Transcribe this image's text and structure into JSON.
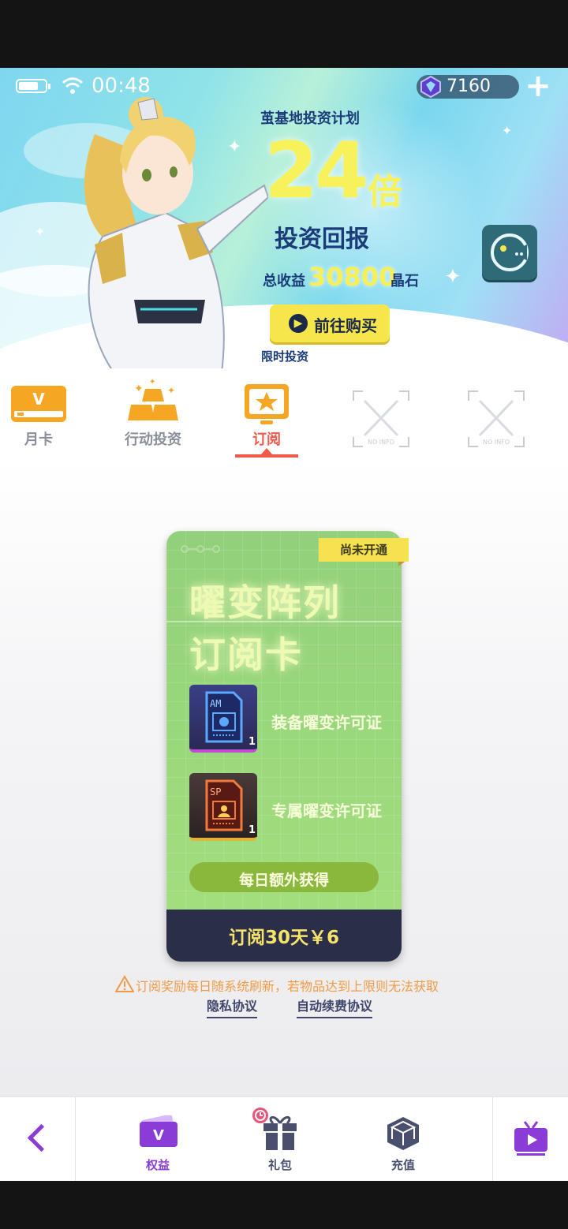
{
  "status_bar": {
    "time": "00:48"
  },
  "currency": {
    "gems": "7160",
    "add_label": "+"
  },
  "banner": {
    "subtitle": "茧基地投资计划",
    "multiplier": "24",
    "multiplier_unit": "倍",
    "headline": "投资回报",
    "total_label": "总收益",
    "total_value": "30800",
    "total_unit": "晶石",
    "buy_label": "前往购买",
    "limited_label": "限时投资"
  },
  "tabs": [
    {
      "label": "月卡",
      "icon": "vip-card-icon",
      "active": false
    },
    {
      "label": "行动投资",
      "icon": "gold-bars-icon",
      "active": false
    },
    {
      "label": "订阅",
      "icon": "star-screen-icon",
      "active": true
    },
    {
      "label": "",
      "icon": "no-info-placeholder-icon",
      "active": false
    },
    {
      "label": "",
      "icon": "no-info-placeholder-icon",
      "active": false
    }
  ],
  "card": {
    "status_badge": "尚未开通",
    "title_line1": "曜变阵列",
    "title_line2": "订阅卡",
    "items": [
      {
        "label": "装备曜变许可证",
        "qty": "1",
        "icon": "am-license-icon"
      },
      {
        "label": "专属曜变许可证",
        "qty": "1",
        "icon": "sp-license-icon"
      }
    ],
    "daily_label": "每日额外获得",
    "subscribe_label": "订阅30天￥6"
  },
  "notice": "订阅奖励每日随系统刷新，若物品达到上限则无法获取",
  "links": {
    "privacy": "隐私协议",
    "auto_renew": "自动续费协议"
  },
  "bottom_nav": [
    {
      "label": "权益",
      "icon": "vip-ticket-icon",
      "active": true
    },
    {
      "label": "礼包",
      "icon": "gift-icon",
      "active": false
    },
    {
      "label": "充值",
      "icon": "cube-icon",
      "active": false
    }
  ],
  "colors": {
    "accent_tab": "#ef5a4a",
    "accent_nav": "#8b3bd6",
    "card_green": "#9ad87c",
    "gold": "#f8f25a"
  }
}
